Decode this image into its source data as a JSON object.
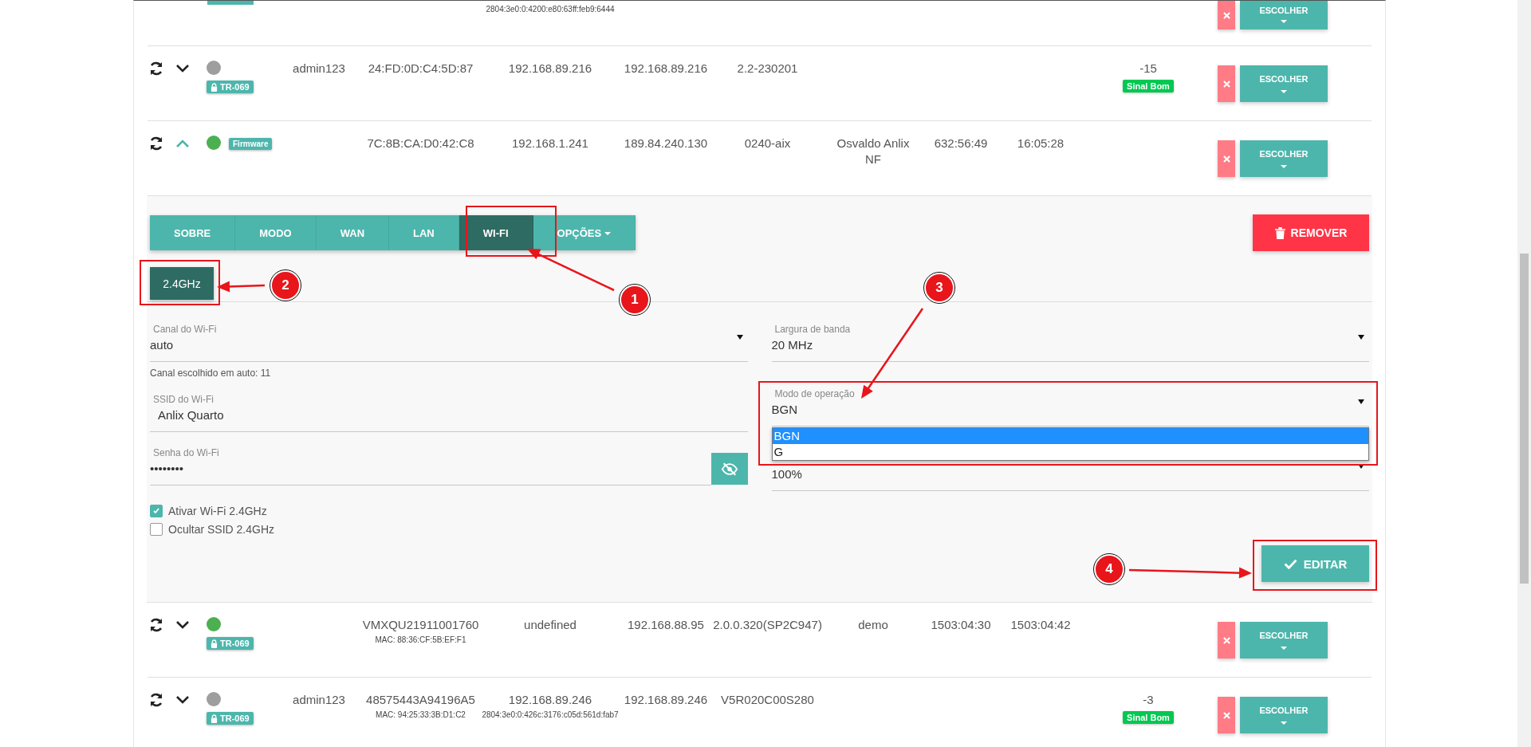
{
  "devices": [
    {
      "kind": "partial",
      "ipv6": "2804:3e0:0:4200:e80:63ff:feb9:6444",
      "action": "ESCOLHER"
    },
    {
      "kind": "device",
      "expanded": false,
      "color": "#9e9e9e",
      "badge": {
        "kind": "tr069",
        "label": "TR-069"
      },
      "user": "admin123",
      "identifier": "24:FD:0D:C4:5D:87",
      "lan_ip": "192.168.89.216",
      "wan_ip": "192.168.89.216",
      "firmware": "2.2-230201",
      "signal": "-15",
      "signal_label": "Sinal Bom",
      "action": "ESCOLHER"
    },
    {
      "kind": "device",
      "expanded": true,
      "color": "#4caf50",
      "badge": {
        "kind": "firmware",
        "label": "Firmware"
      },
      "identifier": "7C:8B:CA:D0:42:C8",
      "lan_ip": "192.168.1.241",
      "wan_ip": "189.84.240.130",
      "firmware": "0240-aix",
      "name": "Osvaldo Anlix NF",
      "uptime": "632:56:49",
      "connection_time": "16:05:28",
      "action": "ESCOLHER"
    },
    {
      "kind": "device",
      "expanded": false,
      "color": "#4caf50",
      "badge": {
        "kind": "tr069",
        "label": "TR-069"
      },
      "identifier": "VMXQU21911001760",
      "mac": "MAC: 88:36:CF:5B:EF:F1",
      "lan_ip": "undefined",
      "wan_ip": "192.168.88.95",
      "firmware": "2.0.0.320(SP2C947)",
      "name": "demo",
      "uptime": "1503:04:30",
      "connection_time": "1503:04:42",
      "action": "ESCOLHER"
    },
    {
      "kind": "device",
      "expanded": false,
      "color": "#9e9e9e",
      "badge": {
        "kind": "tr069",
        "label": "TR-069"
      },
      "user": "admin123",
      "identifier": "48575443A94196A5",
      "mac": "MAC: 94:25:33:3B:D1:C2",
      "lan_ip": "192.168.89.246",
      "ipv6": "2804:3e0:0:426c:3176:c05d:561d:fab7",
      "wan_ip": "192.168.89.246",
      "firmware": "V5R020C00S280",
      "signal": "-3",
      "signal_label": "Sinal Bom",
      "action": "ESCOLHER"
    }
  ],
  "detail_panel": {
    "tabs": [
      {
        "label": "SOBRE",
        "selected": false
      },
      {
        "label": "MODO",
        "selected": false
      },
      {
        "label": "WAN",
        "selected": false
      },
      {
        "label": "LAN",
        "selected": false
      },
      {
        "label": "WI-FI",
        "selected": true
      },
      {
        "label": "OPÇÕES",
        "selected": false,
        "dropdown": true
      }
    ],
    "remove_button": "REMOVER",
    "bands": [
      {
        "label": "2.4GHz",
        "selected": true
      }
    ],
    "left_fields": [
      {
        "kind": "select",
        "label": "Canal do Wi-Fi",
        "value": "auto",
        "hint": "Canal escolhido em auto: 11"
      },
      {
        "kind": "text",
        "label": "SSID do Wi-Fi",
        "value": "Anlix Quarto"
      },
      {
        "kind": "password",
        "label": "Senha do Wi-Fi",
        "value": "••••••••"
      }
    ],
    "right_fields": [
      {
        "kind": "select",
        "label": "Largura de banda",
        "value": "20 MHz"
      },
      {
        "kind": "select",
        "label": "Modo de operação",
        "value": "BGN",
        "options": [
          {
            "label": "BGN",
            "selected": true
          },
          {
            "label": "G",
            "selected": false
          }
        ]
      },
      {
        "kind": "select",
        "value": "100%"
      }
    ],
    "checkboxes": [
      {
        "label": "Ativar Wi-Fi 2.4GHz",
        "checked": true
      },
      {
        "label": "Ocultar SSID 2.4GHz",
        "checked": false
      }
    ],
    "save_button": "EDITAR"
  },
  "annotations": [
    {
      "number": "1"
    },
    {
      "number": "2"
    },
    {
      "number": "3"
    },
    {
      "number": "4"
    }
  ]
}
